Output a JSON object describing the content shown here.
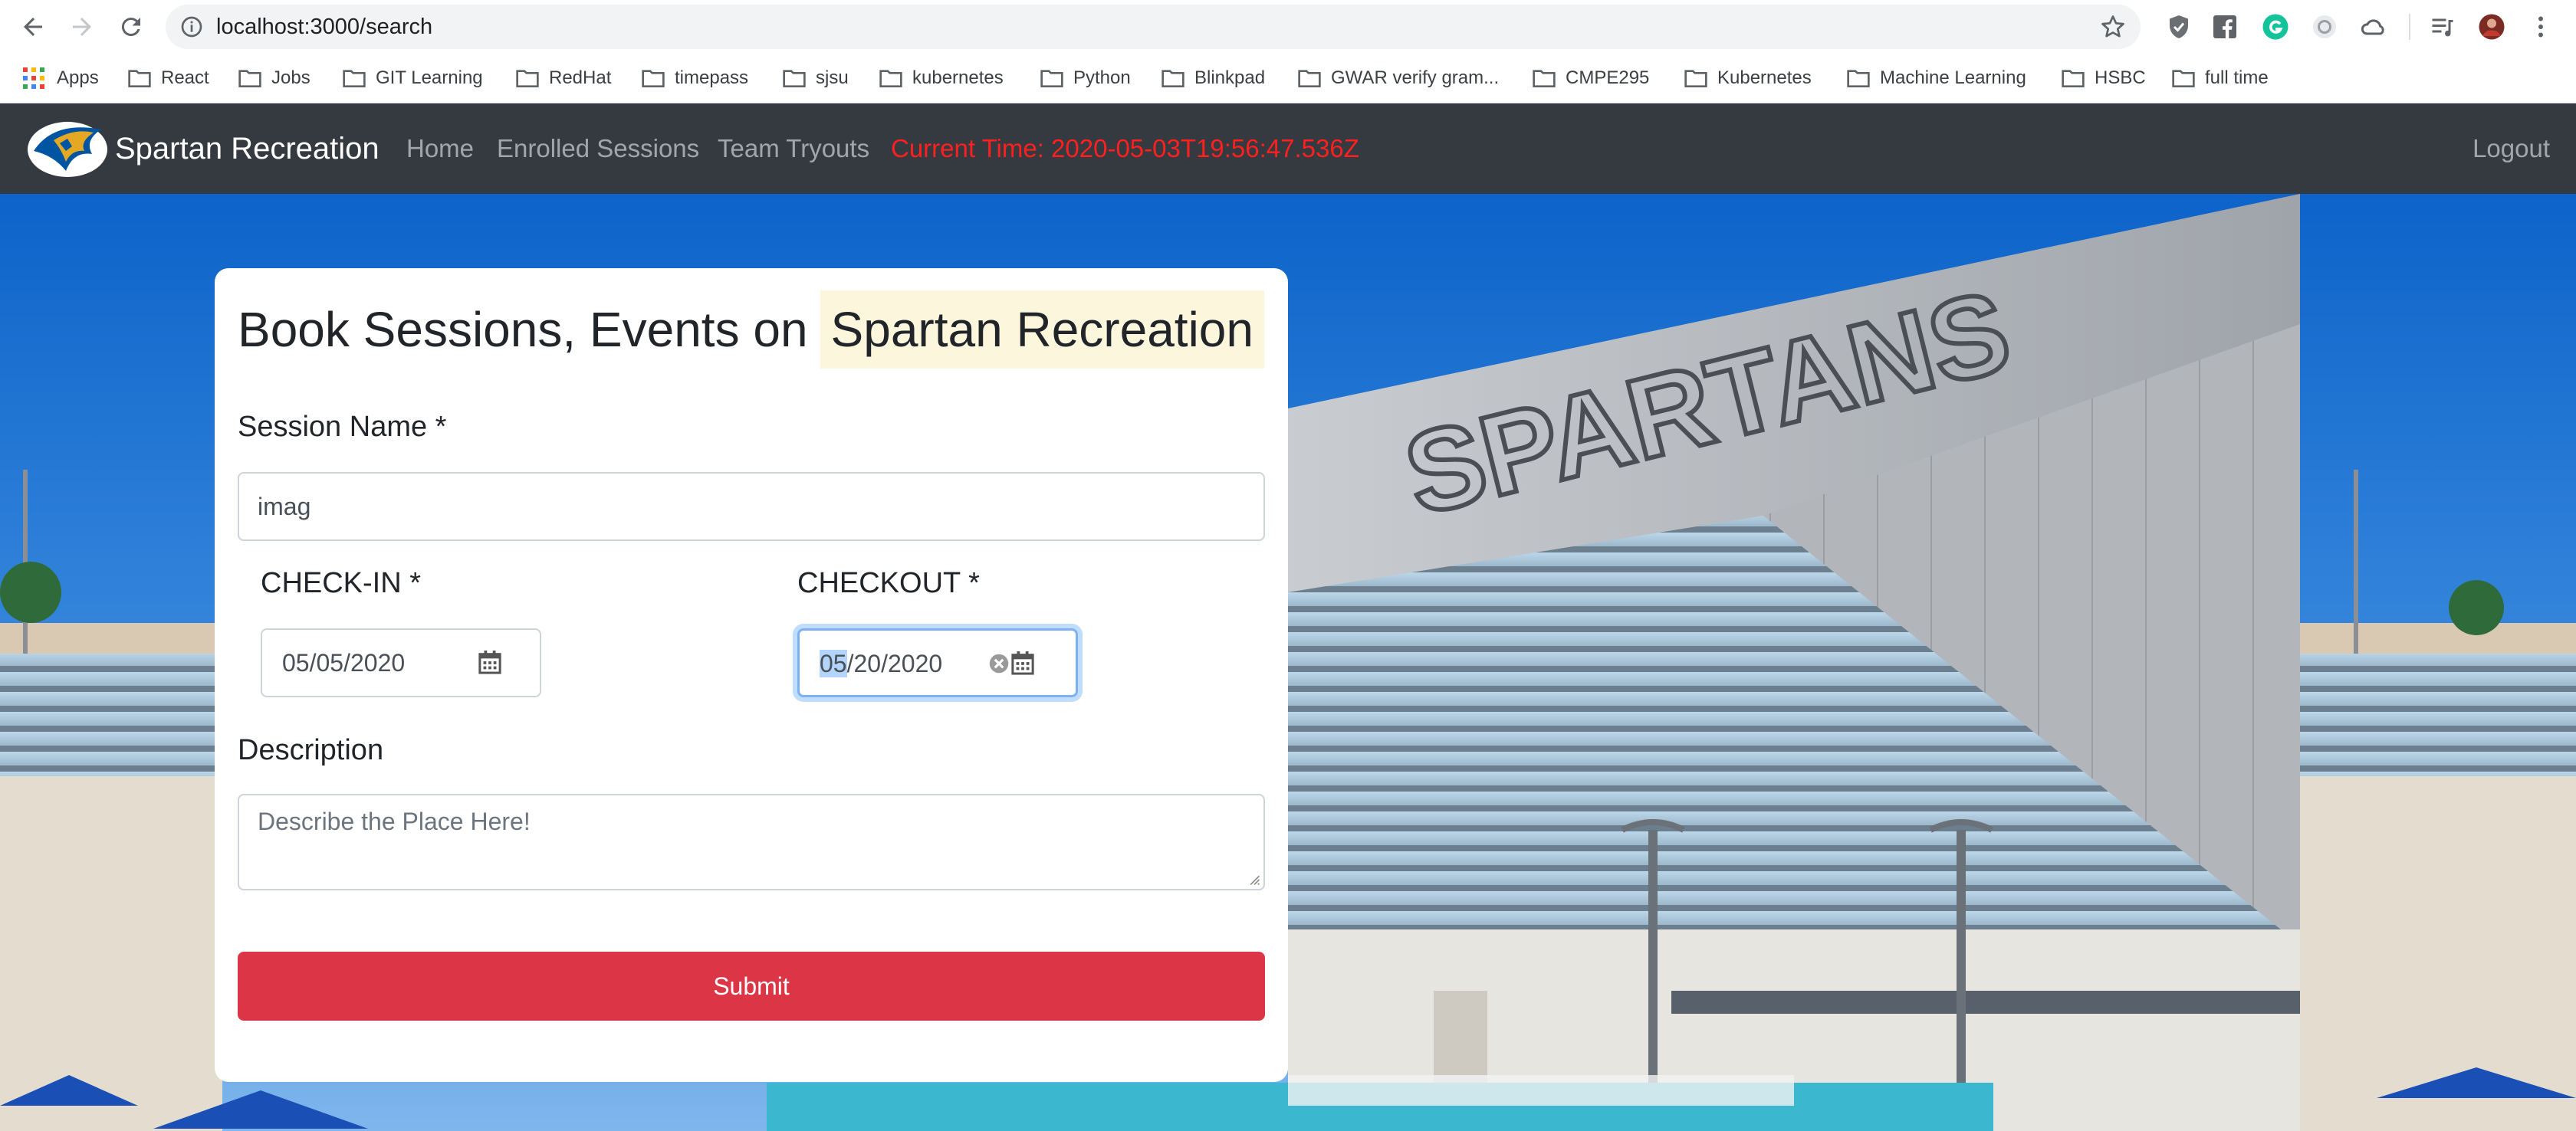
{
  "browser": {
    "url": "localhost:3000/search",
    "bookmarks": [
      "Apps",
      "React",
      "Jobs",
      "GIT Learning",
      "RedHat",
      "timepass",
      "sjsu",
      "kubernetes",
      "Python",
      "Blinkpad",
      "GWAR verify gram...",
      "CMPE295",
      "Kubernetes",
      "Machine Learning",
      "HSBC",
      "full time"
    ]
  },
  "navbar": {
    "brand": "Spartan Recreation",
    "links": [
      "Home",
      "Enrolled Sessions",
      "Team Tryouts"
    ],
    "current_time": "Current Time: 2020-05-03T19:56:47.536Z",
    "logout": "Logout"
  },
  "hero": {
    "sign_text": "SPARTANS"
  },
  "form": {
    "title_prefix": "Book Sessions, Events on",
    "title_highlight": "Spartan Recreation",
    "session_name_label": "Session Name *",
    "session_name_value": "imag",
    "checkin_label": "CHECK-IN *",
    "checkin_value": "05/05/2020",
    "checkout_label": "CHECKOUT *",
    "checkout_month": "05",
    "checkout_rest": "/20/2020",
    "description_label": "Description",
    "description_placeholder": "Describe the Place Here!",
    "submit_label": "Submit"
  },
  "colors": {
    "navbar": "#343a40",
    "submit": "#dc3545",
    "current_time": "#ff1f1f",
    "title_highlight": "#fcf6dd"
  }
}
